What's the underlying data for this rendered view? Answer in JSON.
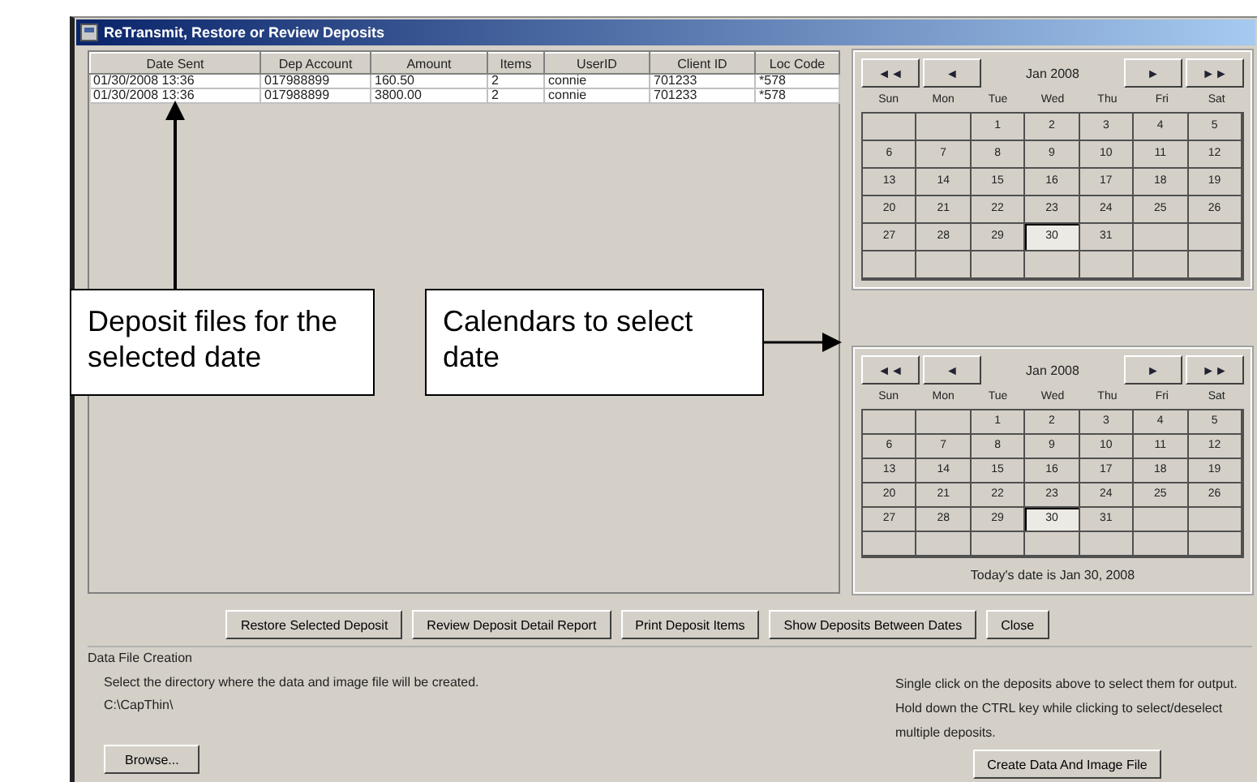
{
  "window": {
    "title": "ReTransmit, Restore or Review Deposits"
  },
  "table": {
    "columns": [
      "Date Sent",
      "Dep Account",
      "Amount",
      "Items",
      "UserID",
      "Client ID",
      "Loc Code"
    ],
    "rows": [
      {
        "selected": false,
        "cells": [
          "01/30/2008 13:36",
          "017988899",
          "160.50",
          "2",
          "connie",
          "701233",
          "*578"
        ]
      },
      {
        "selected": false,
        "cells": [
          "01/30/2008 13:36",
          "017988899",
          "3800.00",
          "2",
          "connie",
          "701233",
          "*578"
        ]
      }
    ]
  },
  "calendars": [
    {
      "nav": [
        "◄◄",
        "◄",
        "►",
        "►►"
      ],
      "month": "Jan 2008",
      "weekdays": [
        "Sun",
        "Mon",
        "Tue",
        "Wed",
        "Thu",
        "Fri",
        "Sat"
      ],
      "weeks": [
        [
          {
            "kind": "blank"
          },
          {
            "kind": "blank"
          },
          {
            "kind": "day",
            "label": "1",
            "selected": false
          },
          {
            "kind": "day",
            "label": "2",
            "selected": false
          },
          {
            "kind": "day",
            "label": "3",
            "selected": false
          },
          {
            "kind": "day",
            "label": "4",
            "selected": false
          },
          {
            "kind": "day",
            "label": "5",
            "selected": false
          }
        ],
        [
          {
            "kind": "day",
            "label": "6",
            "selected": false
          },
          {
            "kind": "day",
            "label": "7",
            "selected": false
          },
          {
            "kind": "day",
            "label": "8",
            "selected": false
          },
          {
            "kind": "day",
            "label": "9",
            "selected": false
          },
          {
            "kind": "day",
            "label": "10",
            "selected": false
          },
          {
            "kind": "day",
            "label": "11",
            "selected": false
          },
          {
            "kind": "day",
            "label": "12",
            "selected": false
          }
        ],
        [
          {
            "kind": "day",
            "label": "13",
            "selected": false
          },
          {
            "kind": "day",
            "label": "14",
            "selected": false
          },
          {
            "kind": "day",
            "label": "15",
            "selected": false
          },
          {
            "kind": "day",
            "label": "16",
            "selected": false
          },
          {
            "kind": "day",
            "label": "17",
            "selected": false
          },
          {
            "kind": "day",
            "label": "18",
            "selected": false
          },
          {
            "kind": "day",
            "label": "19",
            "selected": false
          }
        ],
        [
          {
            "kind": "day",
            "label": "20",
            "selected": false
          },
          {
            "kind": "day",
            "label": "21",
            "selected": false
          },
          {
            "kind": "day",
            "label": "22",
            "selected": false
          },
          {
            "kind": "day",
            "label": "23",
            "selected": false
          },
          {
            "kind": "day",
            "label": "24",
            "selected": false
          },
          {
            "kind": "day",
            "label": "25",
            "selected": false
          },
          {
            "kind": "day",
            "label": "26",
            "selected": false
          }
        ],
        [
          {
            "kind": "day",
            "label": "27",
            "selected": false
          },
          {
            "kind": "day",
            "label": "28",
            "selected": false
          },
          {
            "kind": "day",
            "label": "29",
            "selected": false
          },
          {
            "kind": "day",
            "label": "30",
            "selected": true
          },
          {
            "kind": "day",
            "label": "31",
            "selected": false
          },
          {
            "kind": "blank"
          },
          {
            "kind": "blank"
          }
        ],
        [
          {
            "kind": "blank"
          },
          {
            "kind": "blank"
          },
          {
            "kind": "blank"
          },
          {
            "kind": "blank"
          },
          {
            "kind": "blank"
          },
          {
            "kind": "blank"
          },
          {
            "kind": "blank"
          }
        ]
      ]
    },
    {
      "nav": [
        "◄◄",
        "◄",
        "►",
        "►►"
      ],
      "month": "Jan 2008",
      "weekdays": [
        "Sun",
        "Mon",
        "Tue",
        "Wed",
        "Thu",
        "Fri",
        "Sat"
      ],
      "weeks": [
        [
          {
            "kind": "blank"
          },
          {
            "kind": "blank"
          },
          {
            "kind": "day",
            "label": "1",
            "selected": false
          },
          {
            "kind": "day",
            "label": "2",
            "selected": false
          },
          {
            "kind": "day",
            "label": "3",
            "selected": false
          },
          {
            "kind": "day",
            "label": "4",
            "selected": false
          },
          {
            "kind": "day",
            "label": "5",
            "selected": false
          }
        ],
        [
          {
            "kind": "day",
            "label": "6",
            "selected": false
          },
          {
            "kind": "day",
            "label": "7",
            "selected": false
          },
          {
            "kind": "day",
            "label": "8",
            "selected": false
          },
          {
            "kind": "day",
            "label": "9",
            "selected": false
          },
          {
            "kind": "day",
            "label": "10",
            "selected": false
          },
          {
            "kind": "day",
            "label": "11",
            "selected": false
          },
          {
            "kind": "day",
            "label": "12",
            "selected": false
          }
        ],
        [
          {
            "kind": "day",
            "label": "13",
            "selected": false
          },
          {
            "kind": "day",
            "label": "14",
            "selected": false
          },
          {
            "kind": "day",
            "label": "15",
            "selected": false
          },
          {
            "kind": "day",
            "label": "16",
            "selected": false
          },
          {
            "kind": "day",
            "label": "17",
            "selected": false
          },
          {
            "kind": "day",
            "label": "18",
            "selected": false
          },
          {
            "kind": "day",
            "label": "19",
            "selected": false
          }
        ],
        [
          {
            "kind": "day",
            "label": "20",
            "selected": false
          },
          {
            "kind": "day",
            "label": "21",
            "selected": false
          },
          {
            "kind": "day",
            "label": "22",
            "selected": false
          },
          {
            "kind": "day",
            "label": "23",
            "selected": false
          },
          {
            "kind": "day",
            "label": "24",
            "selected": false
          },
          {
            "kind": "day",
            "label": "25",
            "selected": false
          },
          {
            "kind": "day",
            "label": "26",
            "selected": false
          }
        ],
        [
          {
            "kind": "day",
            "label": "27",
            "selected": false
          },
          {
            "kind": "day",
            "label": "28",
            "selected": false
          },
          {
            "kind": "day",
            "label": "29",
            "selected": false
          },
          {
            "kind": "day",
            "label": "30",
            "selected": true
          },
          {
            "kind": "day",
            "label": "31",
            "selected": false
          },
          {
            "kind": "blank"
          },
          {
            "kind": "blank"
          }
        ],
        [
          {
            "kind": "blank"
          },
          {
            "kind": "blank"
          },
          {
            "kind": "blank"
          },
          {
            "kind": "blank"
          },
          {
            "kind": "blank"
          },
          {
            "kind": "blank"
          },
          {
            "kind": "blank"
          }
        ]
      ],
      "today": "Today's date is Jan 30, 2008"
    }
  ],
  "buttons": [
    "Restore Selected Deposit",
    "Review Deposit Detail Report",
    "Print Deposit Items",
    "Show Deposits Between Dates",
    "Close"
  ],
  "data_file": {
    "title": "Data File Creation",
    "instruction": "Select the directory where the data and image file will be created.",
    "path": "C:\\CapThin\\",
    "browse": "Browse...",
    "help": "Single click on the deposits above to select them for output. Hold down the CTRL key while clicking to select/deselect multiple deposits.",
    "create": "Create Data And Image File"
  },
  "annotations": [
    {
      "text": "Deposit files for the selected date",
      "kind": "up"
    },
    {
      "text": "Calendars to select date",
      "kind": "right"
    }
  ]
}
